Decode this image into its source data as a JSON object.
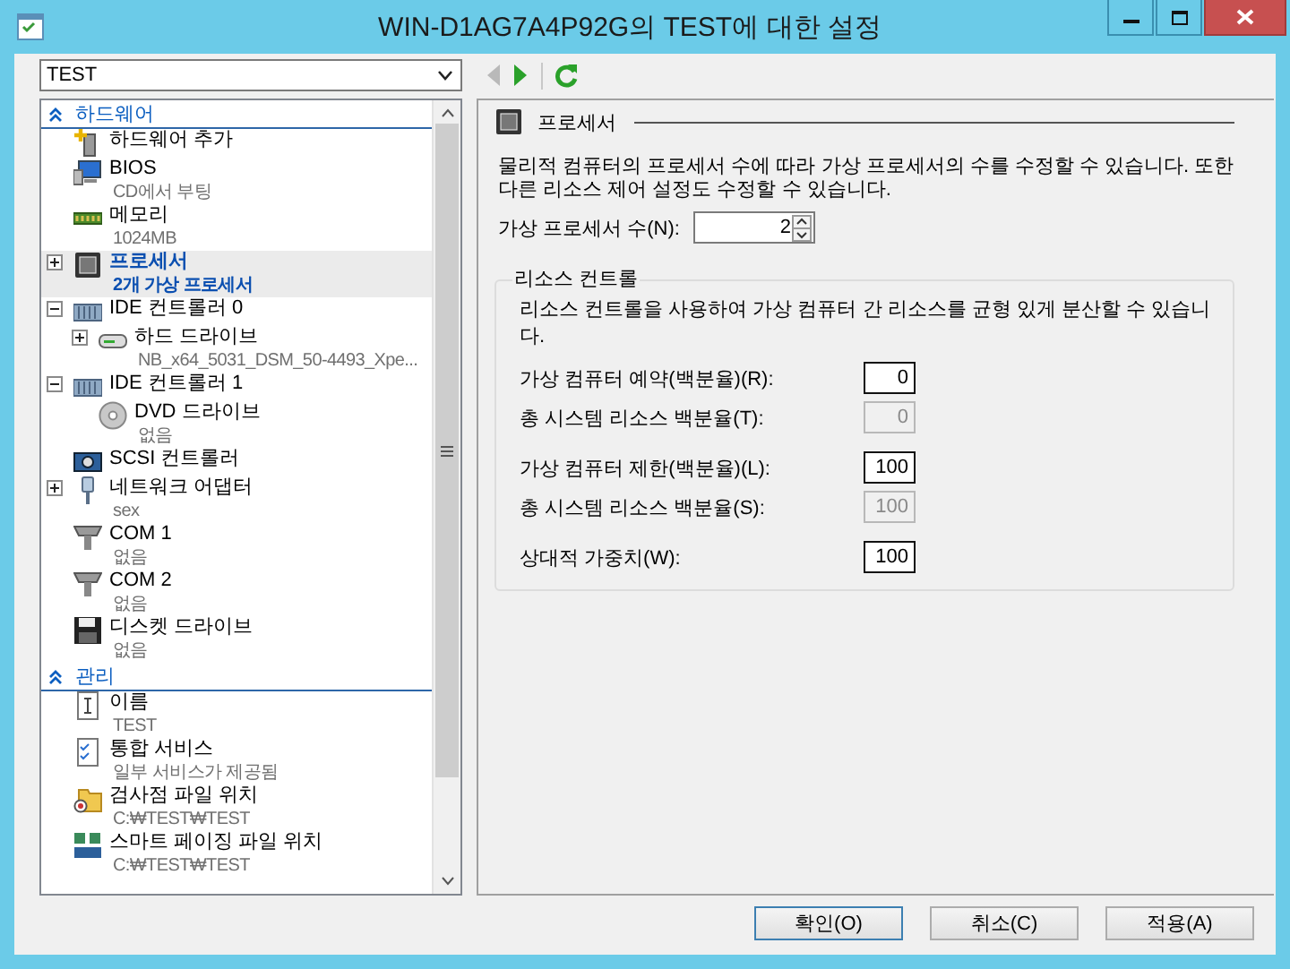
{
  "window": {
    "title": "WIN-D1AG7A4P92G의 TEST에 대한 설정"
  },
  "vm_selector": {
    "value": "TEST"
  },
  "toolbar": [
    {
      "kind": "back",
      "disabled": true
    },
    {
      "kind": "forward",
      "disabled": false
    },
    {
      "kind": "refresh",
      "disabled": false
    }
  ],
  "tree": {
    "sections": [
      {
        "title": "하드웨어",
        "expanded": true,
        "items": [
          {
            "kind": "add",
            "label": "하드웨어 추가",
            "selected": false
          },
          {
            "kind": "bios",
            "label": "BIOS",
            "sublabel": "CD에서 부팅",
            "selected": false
          },
          {
            "kind": "memory",
            "label": "메모리",
            "sublabel": "1024MB",
            "selected": false
          },
          {
            "kind": "processor",
            "label": "프로세서",
            "sublabel": "2개 가상 프로세서",
            "selected": true,
            "expanded": false
          },
          {
            "kind": "controller",
            "label": "IDE 컨트롤러 0",
            "selected": false,
            "expanded": true,
            "children": [
              {
                "kind": "disk",
                "label": "하드 드라이브",
                "sublabel": "NB_x64_5031_DSM_50-4493_Xpe...",
                "selected": false,
                "expanded": false
              }
            ]
          },
          {
            "kind": "controller",
            "label": "IDE 컨트롤러 1",
            "selected": false,
            "expanded": true,
            "children": [
              {
                "kind": "dvd",
                "label": "DVD 드라이브",
                "sublabel": "없음",
                "selected": false
              }
            ]
          },
          {
            "kind": "scsi",
            "label": "SCSI 컨트롤러",
            "selected": false
          },
          {
            "kind": "network",
            "label": "네트워크 어댑터",
            "sublabel": "sex",
            "selected": false,
            "expanded": false
          },
          {
            "kind": "com",
            "label": "COM 1",
            "sublabel": "없음",
            "selected": false
          },
          {
            "kind": "com",
            "label": "COM 2",
            "sublabel": "없음",
            "selected": false
          },
          {
            "kind": "floppy",
            "label": "디스켓 드라이브",
            "sublabel": "없음",
            "selected": false
          }
        ]
      },
      {
        "title": "관리",
        "expanded": true,
        "items": [
          {
            "kind": "name",
            "label": "이름",
            "sublabel": "TEST",
            "selected": false
          },
          {
            "kind": "services",
            "label": "통합 서비스",
            "sublabel": "일부 서비스가 제공됨",
            "selected": false
          },
          {
            "kind": "checkpoint",
            "label": "검사점 파일 위치",
            "sublabel": "C:₩TEST₩TEST",
            "selected": false
          },
          {
            "kind": "paging",
            "label": "스마트 페이징 파일 위치",
            "sublabel": "C:₩TEST₩TEST",
            "selected": false
          }
        ]
      }
    ]
  },
  "panel": {
    "title": "프로세서",
    "description": "물리적 컴퓨터의 프로세서 수에 따라 가상 프로세서의 수를 수정할 수 있습니다. 또한 다른 리소스 제어 설정도 수정할 수 있습니다.",
    "processor_count": {
      "label": "가상 프로세서 수(N):",
      "value": "2"
    },
    "resource_control": {
      "title": "리소스 컨트롤",
      "description": "리소스 컨트롤을 사용하여 가상 컴퓨터 간 리소스를 균형 있게 분산할 수 있습니다.",
      "field_groups": [
        [
          {
            "label": "가상 컴퓨터 예약(백분율)(R):",
            "value": "0",
            "disabled": false
          },
          {
            "label": "총 시스템 리소스 백분율(T):",
            "value": "0",
            "disabled": true
          }
        ],
        [
          {
            "label": "가상 컴퓨터 제한(백분율)(L):",
            "value": "100",
            "disabled": false
          },
          {
            "label": "총 시스템 리소스 백분율(S):",
            "value": "100",
            "disabled": true
          }
        ],
        [
          {
            "label": "상대적 가중치(W):",
            "value": "100",
            "disabled": false
          }
        ]
      ]
    }
  },
  "buttons": [
    {
      "label": "확인(O)",
      "default": true
    },
    {
      "label": "취소(C)",
      "default": false
    },
    {
      "label": "적용(A)",
      "default": false
    }
  ]
}
